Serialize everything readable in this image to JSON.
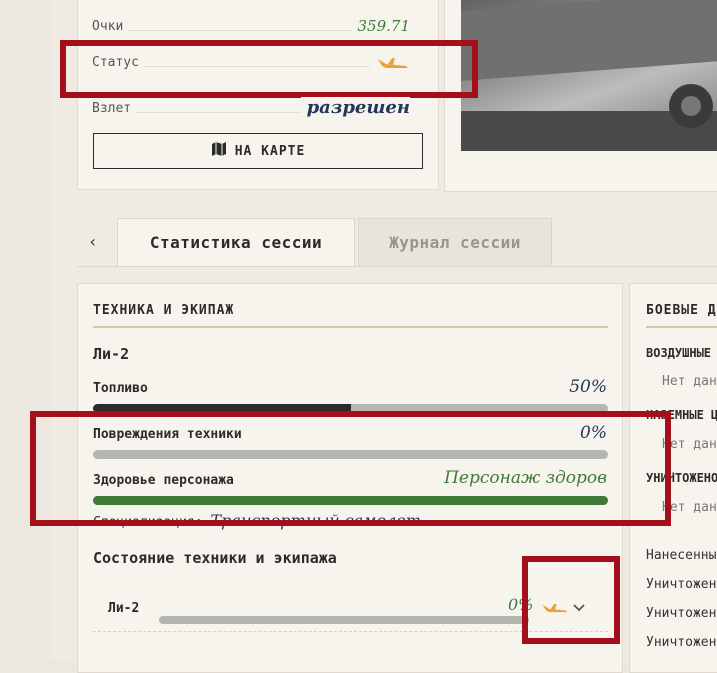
{
  "info": {
    "rows": [
      {
        "label": "Очки",
        "value": "359.71"
      },
      {
        "label": "Статус",
        "value": ""
      },
      {
        "label": "Взлет",
        "value": "разрешен"
      }
    ],
    "map_button": "НА КАРТЕ"
  },
  "tabs": [
    {
      "label": "Статистика сессии",
      "active": true
    },
    {
      "label": "Журнал сессии",
      "active": false
    }
  ],
  "vehicle_panel": {
    "title": "ТЕХНИКА И ЭКИПАЖ",
    "vehicle": "Ли-2",
    "stats": [
      {
        "label": "Топливо",
        "value": "50%",
        "fraction": 0.5
      },
      {
        "label": "Повреждения техники",
        "value": "0%",
        "fraction": 0
      },
      {
        "label": "Здоровье персонажа",
        "value": "Персонаж здоров",
        "fraction": 1
      }
    ],
    "specialization_label": "Специализация:",
    "specialization_value": "Транспортный самолет",
    "section_title": "Состояние техники и экипажа",
    "crew_row": {
      "name": "Ли-2",
      "value": "0%"
    }
  },
  "combat_panel": {
    "title": "БОЕВЫЕ ДЕЙСТВИЯ",
    "groups": [
      {
        "heading": "ВОЗДУШНЫЕ ЦЕЛИ",
        "empty": "Нет данных"
      },
      {
        "heading": "НАЗЕМНЫЕ ЦЕЛИ",
        "empty": "Нет данных"
      },
      {
        "heading": "УНИЧТОЖЕНО",
        "empty": "Нет данных"
      }
    ],
    "rows": [
      "Нанесенный урон",
      "Уничтожено",
      "Уничтожено",
      "Уничтожено"
    ]
  },
  "colors": {
    "accent_red": "#a40f1e",
    "health_green": "#3f7a37",
    "fuel_dark": "#2b2b2b",
    "plane_orange": "#e8a43a"
  },
  "icons": [
    "map-icon",
    "plane-icon",
    "chevron-left-icon",
    "chevron-down-icon"
  ]
}
